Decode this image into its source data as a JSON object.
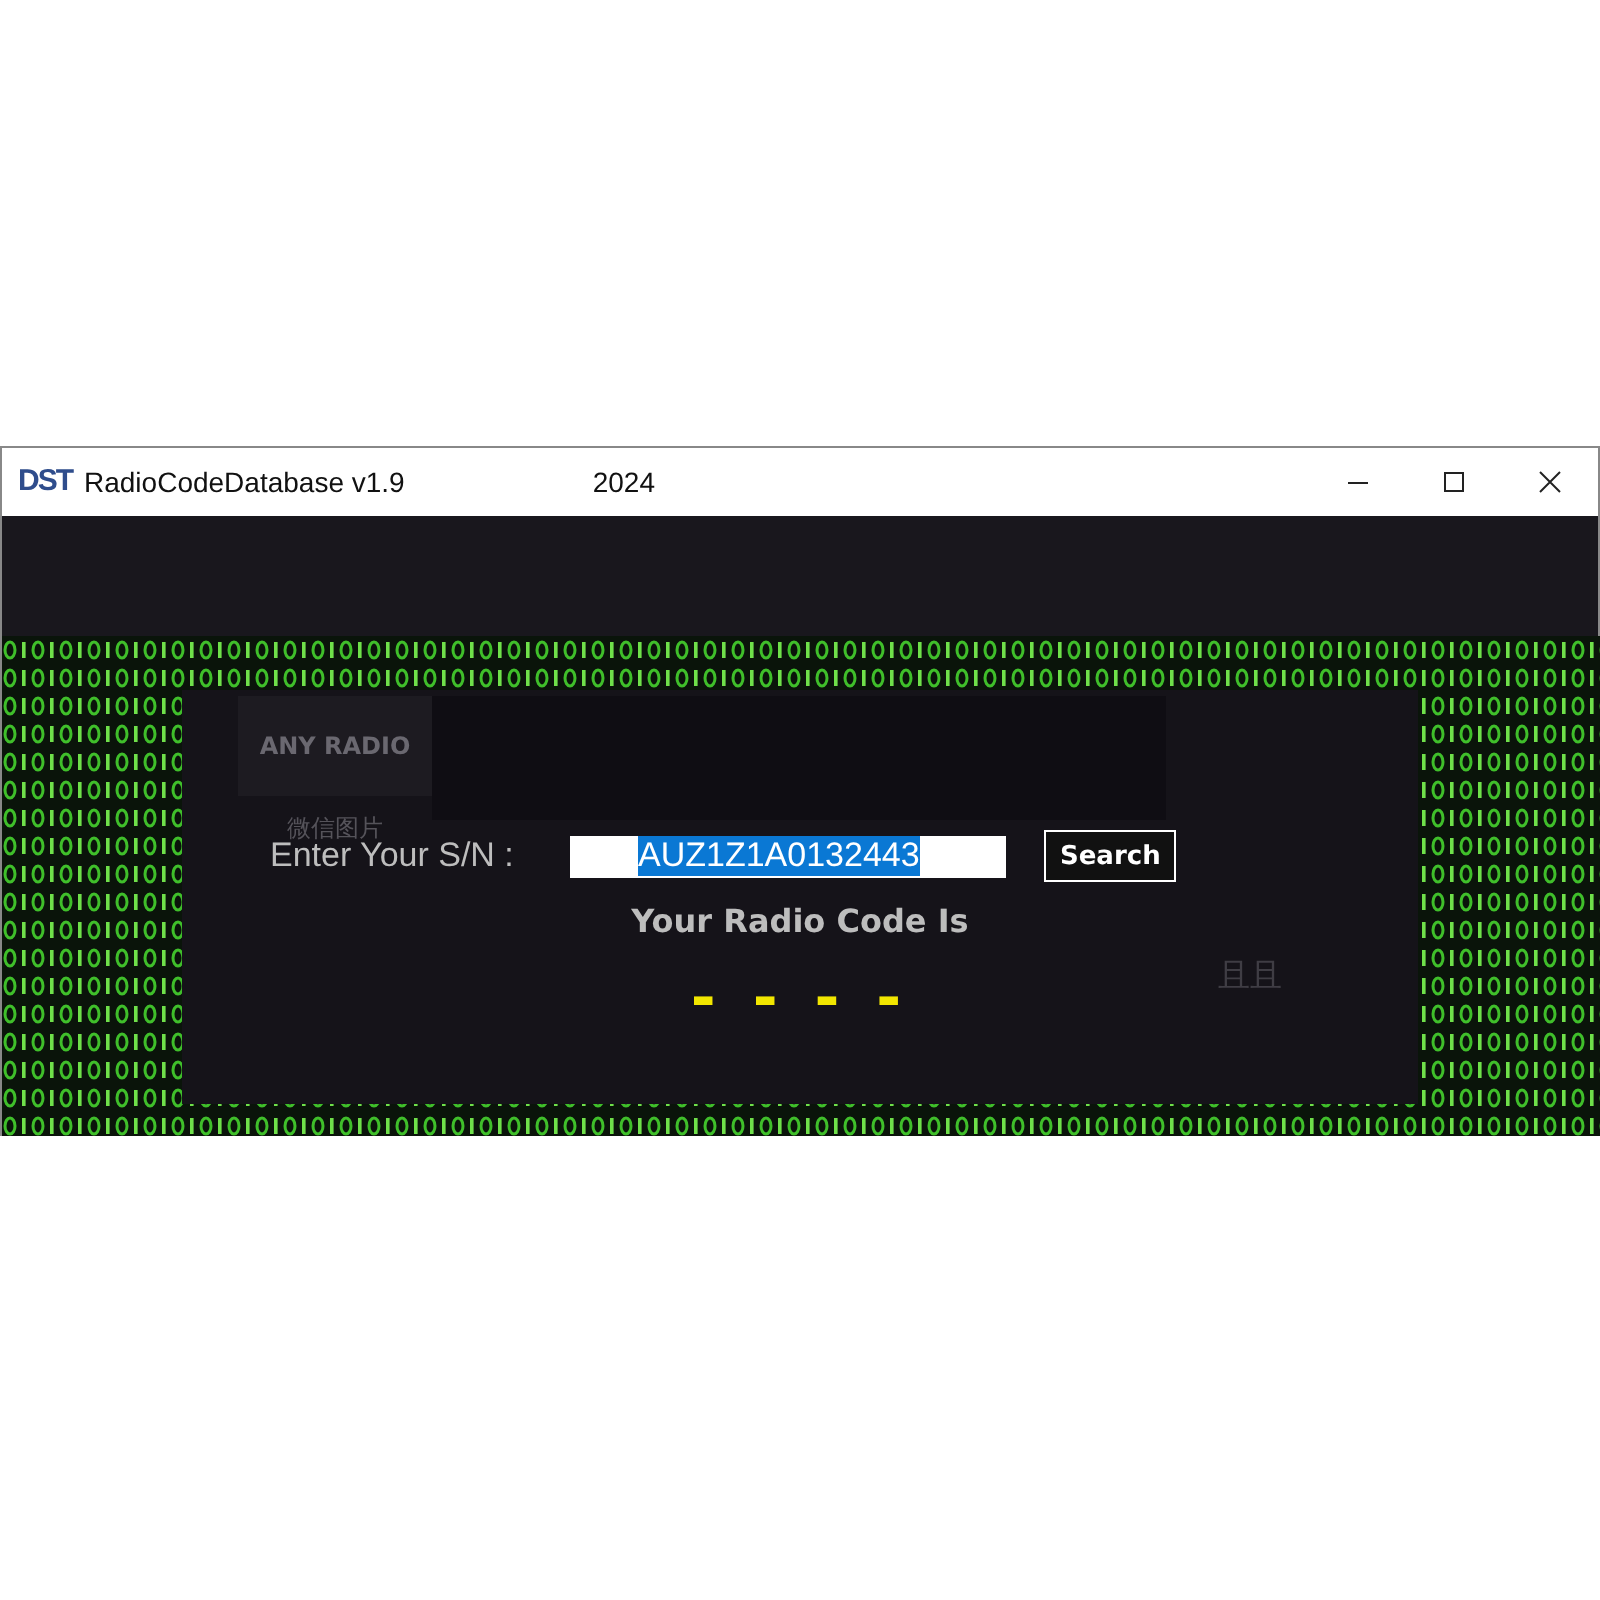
{
  "window": {
    "logo": "DST",
    "title": "RadioCodeDatabase v1.9",
    "title_suffix": "2024"
  },
  "ghost": {
    "badge": "ANY RADIO",
    "caption": "微信图片",
    "name": "且且"
  },
  "form": {
    "label": "Enter Your S/N :",
    "value": "AUZ1Z1A0132443",
    "value_selected": true,
    "button": "Search"
  },
  "result": {
    "heading": "Your Radio Code Is",
    "code": "- - - -"
  }
}
